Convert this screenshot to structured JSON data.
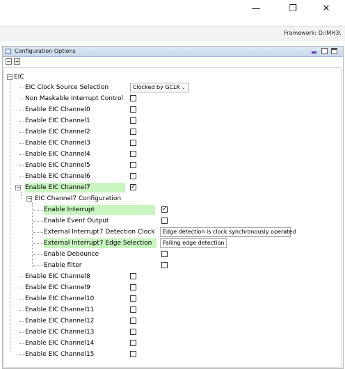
{
  "window": {
    "minimize_glyph": "—",
    "maximize_glyph": "❐",
    "close_glyph": "✕"
  },
  "toolbar": {
    "framework": "Framework: D:\\MH3\\"
  },
  "panel": {
    "title": "Configuration Options",
    "collapse_all": "−",
    "expand_all": "+"
  },
  "tree": {
    "root": "EIC",
    "clock_source_label": "EIC Clock Source Selection",
    "clock_source_value": "Clocked by GCLK",
    "nmi_label": "Non Maskable Interrupt Control",
    "channels_a": [
      "Enable EIC Channel0",
      "Enable EIC Channel1",
      "Enable EIC Channel2",
      "Enable EIC Channel3",
      "Enable EIC Channel4",
      "Enable EIC Channel5",
      "Enable EIC Channel6"
    ],
    "channel7_label": "Enable EIC Channel7",
    "channel7_checked": true,
    "ch7_config_label": "EIC Channel7 Configuration",
    "ch7": {
      "enable_interrupt": "Enable Interrupt",
      "enable_interrupt_checked": true,
      "enable_event_output": "Enable Event Output",
      "detection_clock_label": "External Interrupt7 Detection Clock",
      "detection_clock_value": "Edge detection is clock synchronously operated",
      "edge_selection_label": "External Interrupt7 Edge Selection",
      "edge_selection_value": "Falling edge detection",
      "enable_debounce": "Enable Debounce",
      "enable_filter": "Enable filter"
    },
    "channels_b": [
      "Enable EIC Channel8",
      "Enable EIC Channel9",
      "Enable EIC Channel10",
      "Enable EIC Channel11",
      "Enable EIC Channel12",
      "Enable EIC Channel13",
      "Enable EIC Channel14",
      "Enable EIC Channel15"
    ],
    "check_glyph": "✓",
    "dropdown_glyph": "⌄"
  },
  "colors": {
    "highlight": "#c8f5c0"
  }
}
